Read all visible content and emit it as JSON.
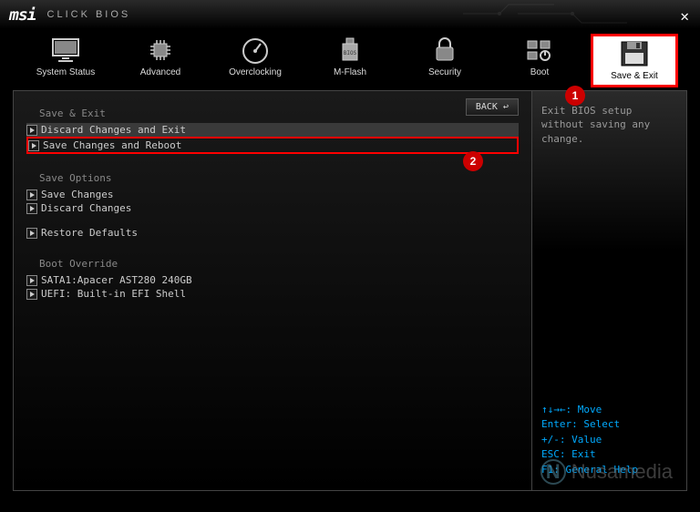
{
  "header": {
    "brand": "msi",
    "title": "CLICK BIOS"
  },
  "nav": [
    {
      "label": "System Status"
    },
    {
      "label": "Advanced"
    },
    {
      "label": "Overclocking"
    },
    {
      "label": "M-Flash"
    },
    {
      "label": "Security"
    },
    {
      "label": "Boot"
    },
    {
      "label": "Save & Exit"
    }
  ],
  "back_label": "BACK ↩",
  "sections": {
    "save_exit_title": "Save & Exit",
    "discard_exit": "Discard Changes and Exit",
    "save_reboot": "Save Changes and Reboot",
    "save_options_title": "Save Options",
    "save_changes": "Save Changes",
    "discard_changes": "Discard Changes",
    "restore_defaults": "Restore Defaults",
    "boot_override_title": "Boot Override",
    "boot1": "SATA1:Apacer AST280 240GB",
    "boot2": "UEFI: Built-in EFI Shell"
  },
  "help_text": "Exit BIOS setup without saving any change.",
  "key_hints": {
    "move": "↑↓→←: Move",
    "enter": "Enter: Select",
    "value": "+/-: Value",
    "esc": "ESC: Exit",
    "f1": "F1: General Help"
  },
  "badges": {
    "one": "1",
    "two": "2"
  },
  "watermark": "Nusamedia"
}
